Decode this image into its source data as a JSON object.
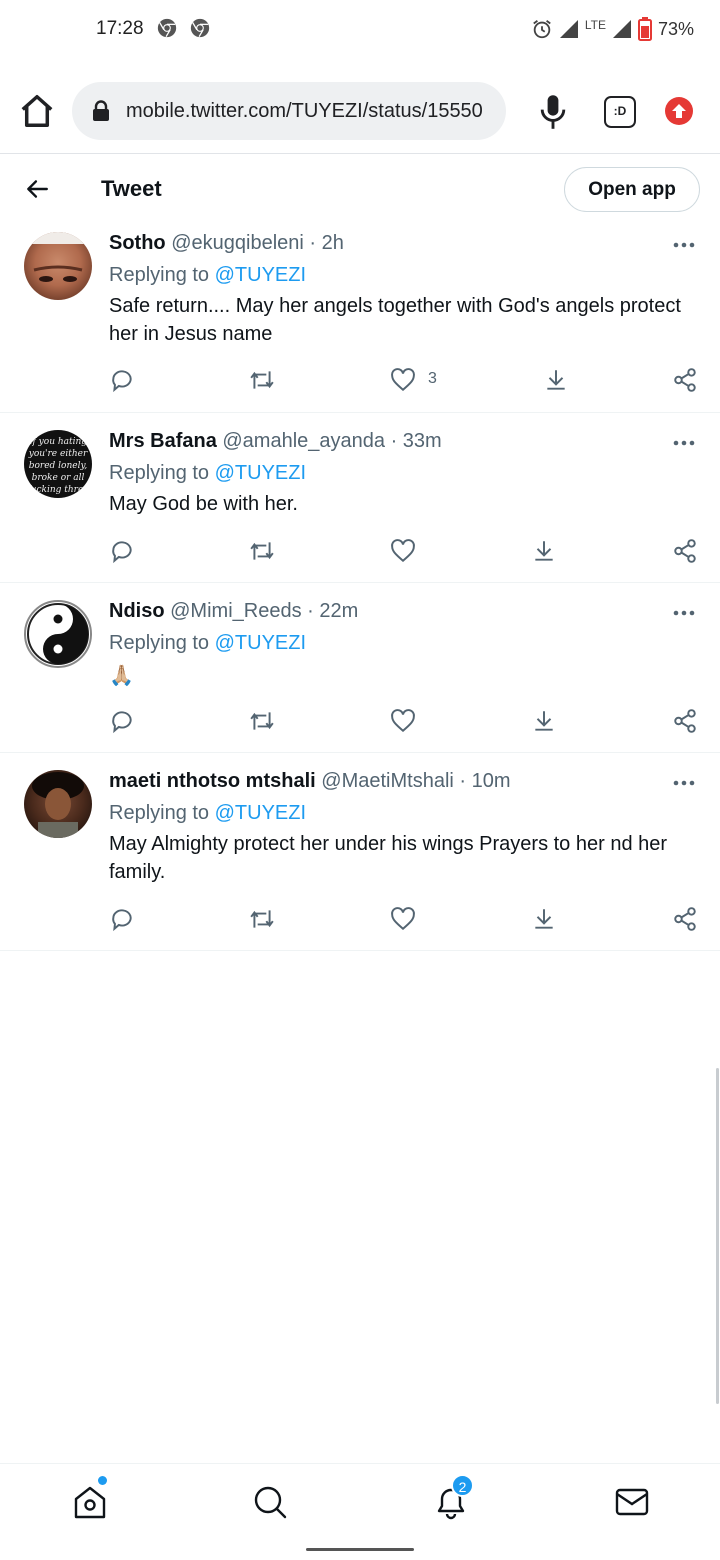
{
  "status_bar": {
    "time": "17:28",
    "network": "LTE",
    "battery": "73%",
    "icons": [
      "chrome-icon",
      "chrome-icon",
      "alarm-icon",
      "signal-icon",
      "battery-icon"
    ]
  },
  "browser": {
    "url": "mobile.twitter.com/TUYEZI/status/15550"
  },
  "header": {
    "title": "Tweet",
    "open_app_label": "Open app"
  },
  "replies": [
    {
      "name": "Sotho",
      "handle": "@ekugqibeleni",
      "time": "· 2h",
      "replying_prefix": "Replying to",
      "replying_to": "@TUYEZI",
      "text": "Safe return.... May her angels together with God's angels protect her in Jesus name",
      "likes": "3"
    },
    {
      "name": "Mrs Bafana",
      "handle": "@amahle_ayanda",
      "time": "· 33m",
      "replying_prefix": "Replying to",
      "replying_to": "@TUYEZI",
      "text": "May God be with her.",
      "likes": "",
      "avatar_text": "If you hating you're either bored lonely, broke or all fucking three"
    },
    {
      "name": "Ndiso",
      "handle": "@Mimi_Reeds",
      "time": "· 22m",
      "replying_prefix": "Replying to",
      "replying_to": "@TUYEZI",
      "text": "🙏🏼",
      "likes": ""
    },
    {
      "name": "maeti nthotso mtshali",
      "handle": "@MaetiMtshali",
      "time": "· 10m",
      "replying_prefix": "Replying to",
      "replying_to": "@TUYEZI",
      "text": "May Almighty protect her under his wings Prayers to her nd her family.",
      "likes": ""
    }
  ],
  "bottom_nav": {
    "notification_count": "2",
    "items": [
      "home-icon",
      "search-icon",
      "bell-icon",
      "mail-icon"
    ]
  },
  "colors": {
    "accent": "#1d9bf0",
    "text": "#0f1419",
    "muted": "#536471",
    "upload_red": "#e53935"
  }
}
